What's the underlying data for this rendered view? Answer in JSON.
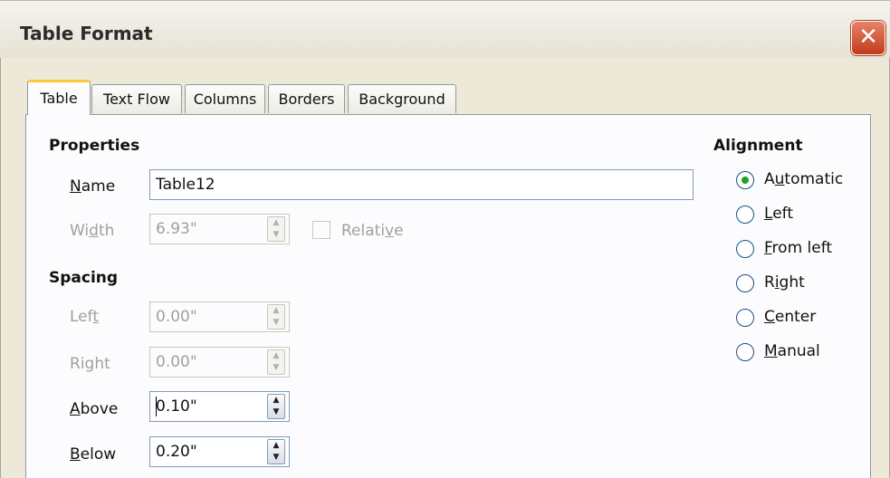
{
  "window": {
    "title": "Table Format",
    "close_glyph": "✕"
  },
  "tabs": [
    {
      "label": "Table",
      "active": true
    },
    {
      "label": "Text Flow",
      "active": false
    },
    {
      "label": "Columns",
      "active": false
    },
    {
      "label": "Borders",
      "active": false
    },
    {
      "label": "Background",
      "active": false
    }
  ],
  "properties": {
    "heading": "Properties",
    "name": {
      "label_mnemonic": "N",
      "label_rest": "ame",
      "value": "Table12"
    },
    "width": {
      "label_pre": "Wi",
      "label_mnemonic": "d",
      "label_post": "th",
      "value": "6.93\"",
      "enabled": false
    },
    "relative": {
      "label_pre": "Relati",
      "label_mnemonic": "v",
      "label_post": "e",
      "checked": false,
      "enabled": false
    }
  },
  "spacing": {
    "heading": "Spacing",
    "left": {
      "label_pre": "Lef",
      "label_mnemonic": "t",
      "value": "0.00\"",
      "enabled": false
    },
    "right": {
      "label": "Right",
      "value": "0.00\"",
      "enabled": false
    },
    "above": {
      "label_mnemonic": "A",
      "label_rest": "bove",
      "value": "0.10\"",
      "enabled": true
    },
    "below": {
      "label_mnemonic": "B",
      "label_rest": "elow",
      "value": "0.20\"",
      "enabled": true
    }
  },
  "alignment": {
    "heading": "Alignment",
    "selected": "Automatic",
    "options": [
      {
        "pre": "A",
        "mn": "u",
        "post": "tomatic"
      },
      {
        "pre": "",
        "mn": "L",
        "post": "eft"
      },
      {
        "pre": "",
        "mn": "F",
        "post": "rom left"
      },
      {
        "pre": "R",
        "mn": "i",
        "post": "ght"
      },
      {
        "pre": "",
        "mn": "C",
        "post": "enter"
      },
      {
        "pre": "",
        "mn": "M",
        "post": "anual"
      }
    ]
  },
  "icons": {
    "spin_up": "▲",
    "spin_down": "▼"
  },
  "colors": {
    "radio_selected_dot": "#21a121",
    "active_tab_accent": "#ffc83c",
    "close_button": "#c03a1c"
  }
}
